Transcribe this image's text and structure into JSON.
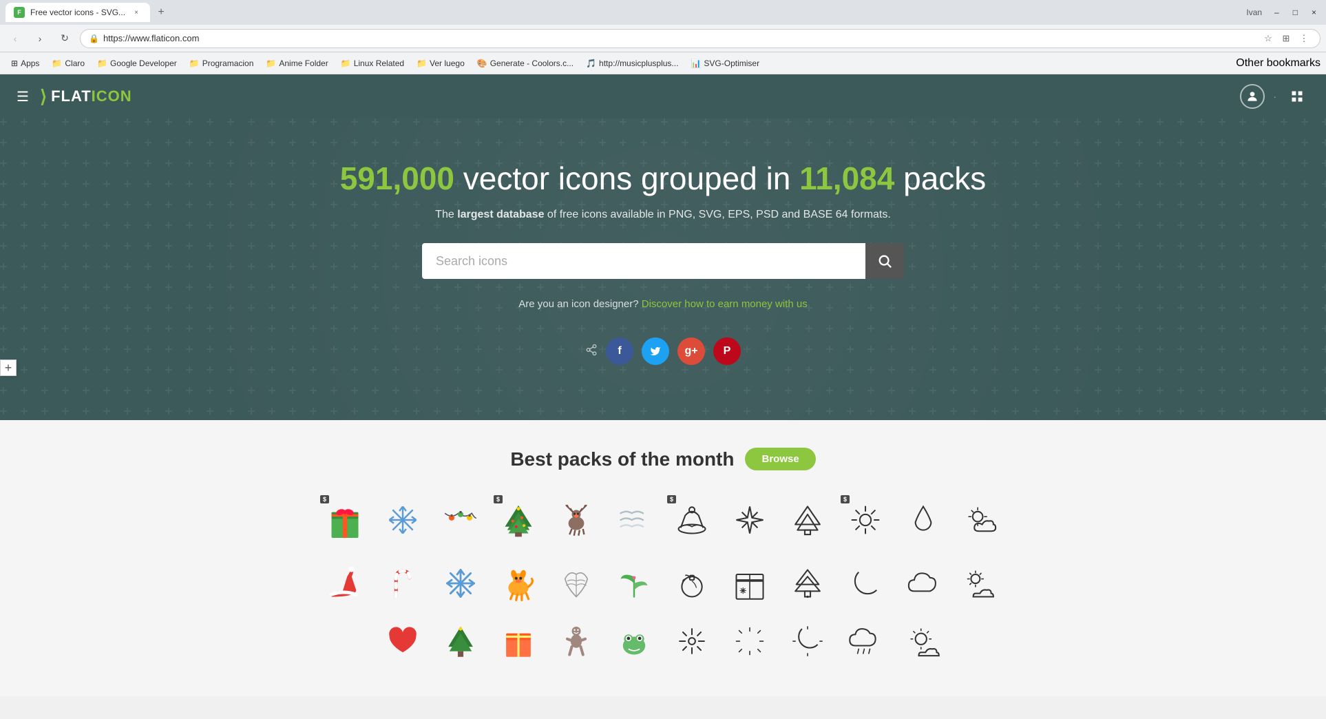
{
  "browser": {
    "tab": {
      "favicon": "F",
      "title": "Free vector icons - SVG...",
      "close": "×"
    },
    "new_tab": "+",
    "user_name": "Ivan",
    "window_controls": {
      "minimize": "–",
      "maximize": "□",
      "close": "×"
    },
    "nav": {
      "back": "‹",
      "forward": "›",
      "refresh": "↻",
      "home": "⌂"
    },
    "address": {
      "secure_label": "Secure",
      "url": "https://www.flaticon.com",
      "star_icon": "☆",
      "extensions_icon": "⊞",
      "menu_icon": "⋮"
    },
    "bookmarks": [
      {
        "label": "Apps",
        "icon": "⊞"
      },
      {
        "label": "Claro",
        "icon": "📁"
      },
      {
        "label": "Google Developer",
        "icon": "📁"
      },
      {
        "label": "Programacion",
        "icon": "📁"
      },
      {
        "label": "Anime Folder",
        "icon": "📁"
      },
      {
        "label": "Linux Related",
        "icon": "📁"
      },
      {
        "label": "Ver luego",
        "icon": "📁"
      },
      {
        "label": "Generate - Coolors.c...",
        "icon": "🎨"
      },
      {
        "label": "http://musicplusplus...",
        "icon": "🎵"
      },
      {
        "label": "SVG-Optimiser",
        "icon": "📊"
      }
    ],
    "bookmarks_right": "Other bookmarks"
  },
  "site": {
    "logo_text": "FLATICON",
    "hamburger": "☰",
    "user_icon": "👤",
    "grid_icon": "⊞",
    "hero": {
      "count1": "591,000",
      "text1": " vector icons grouped in ",
      "count2": "11,084",
      "text2": " packs",
      "subtitle_pre": "The ",
      "subtitle_bold": "largest database",
      "subtitle_post": " of free icons available in PNG, SVG, EPS, PSD and BASE 64 formats.",
      "search_placeholder": "Search icons",
      "designer_pre": "Are you an icon designer? ",
      "designer_link": "Discover how to earn money with us"
    },
    "content": {
      "section_title": "Best packs of the month",
      "browse_btn": "Browse"
    }
  },
  "colors": {
    "accent": "#8dc63f",
    "header_bg": "#3d5a5a",
    "search_btn_bg": "#555555",
    "text_dark": "#333333",
    "facebook": "#3b5998",
    "twitter": "#1da1f2",
    "google": "#dd4b39",
    "pinterest": "#bd081c"
  }
}
